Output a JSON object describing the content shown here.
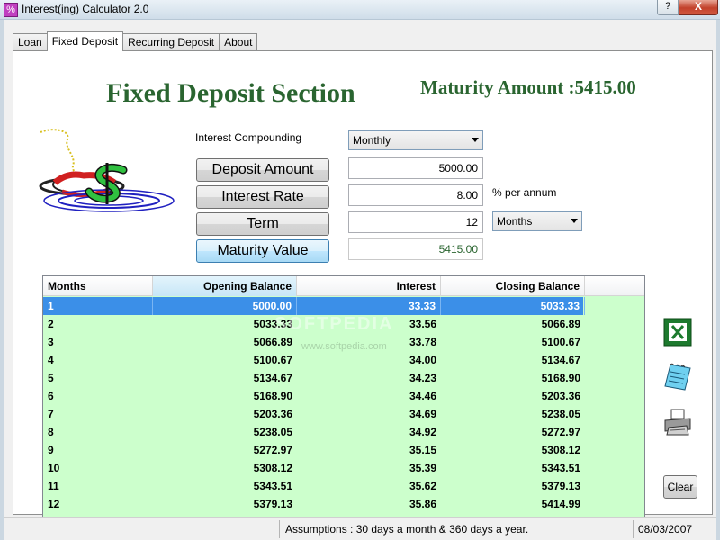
{
  "window": {
    "title": "Interest(ing) Calculator 2.0",
    "help_label": "?",
    "close_label": "X"
  },
  "tabs": [
    {
      "label": "Loan"
    },
    {
      "label": "Fixed Deposit"
    },
    {
      "label": "Recurring Deposit"
    },
    {
      "label": "About"
    }
  ],
  "section": {
    "title": "Fixed Deposit Section",
    "maturity_label": "Maturity Amount :",
    "maturity_value": "5415.00"
  },
  "form": {
    "compounding_label": "Interest Compounding",
    "compounding_value": "Monthly",
    "deposit_button": "Deposit Amount",
    "deposit_value": "5000.00",
    "rate_button": "Interest Rate",
    "rate_value": "8.00",
    "rate_unit": "% per annum",
    "term_button": "Term",
    "term_value": "12",
    "term_unit_value": "Months",
    "maturity_button": "Maturity Value",
    "maturity_value": "5415.00"
  },
  "table": {
    "headers": [
      "Months",
      "Opening Balance",
      "Interest",
      "Closing Balance"
    ],
    "rows": [
      [
        "1",
        "5000.00",
        "33.33",
        "5033.33"
      ],
      [
        "2",
        "5033.33",
        "33.56",
        "5066.89"
      ],
      [
        "3",
        "5066.89",
        "33.78",
        "5100.67"
      ],
      [
        "4",
        "5100.67",
        "34.00",
        "5134.67"
      ],
      [
        "5",
        "5134.67",
        "34.23",
        "5168.90"
      ],
      [
        "6",
        "5168.90",
        "34.46",
        "5203.36"
      ],
      [
        "7",
        "5203.36",
        "34.69",
        "5238.05"
      ],
      [
        "8",
        "5238.05",
        "34.92",
        "5272.97"
      ],
      [
        "9",
        "5272.97",
        "35.15",
        "5308.12"
      ],
      [
        "10",
        "5308.12",
        "35.39",
        "5343.51"
      ],
      [
        "11",
        "5343.51",
        "35.62",
        "5379.13"
      ],
      [
        "12",
        "5379.13",
        "35.86",
        "5414.99"
      ]
    ],
    "selected_row": 1
  },
  "watermark": {
    "main": "SOFTPEDIA",
    "sub": "www.softpedia.com"
  },
  "side_actions": {
    "excel_icon": "excel-export-icon",
    "notepad_icon": "notepad-export-icon",
    "print_icon": "printer-icon",
    "clear_label": "Clear"
  },
  "status": {
    "assumptions": "Assumptions : 30 days a month & 360 days a year.",
    "date": "08/03/2007"
  },
  "colors": {
    "title_green": "#2a6530",
    "grid_background": "#ccffcc",
    "selection_blue": "#3b8fe8"
  }
}
